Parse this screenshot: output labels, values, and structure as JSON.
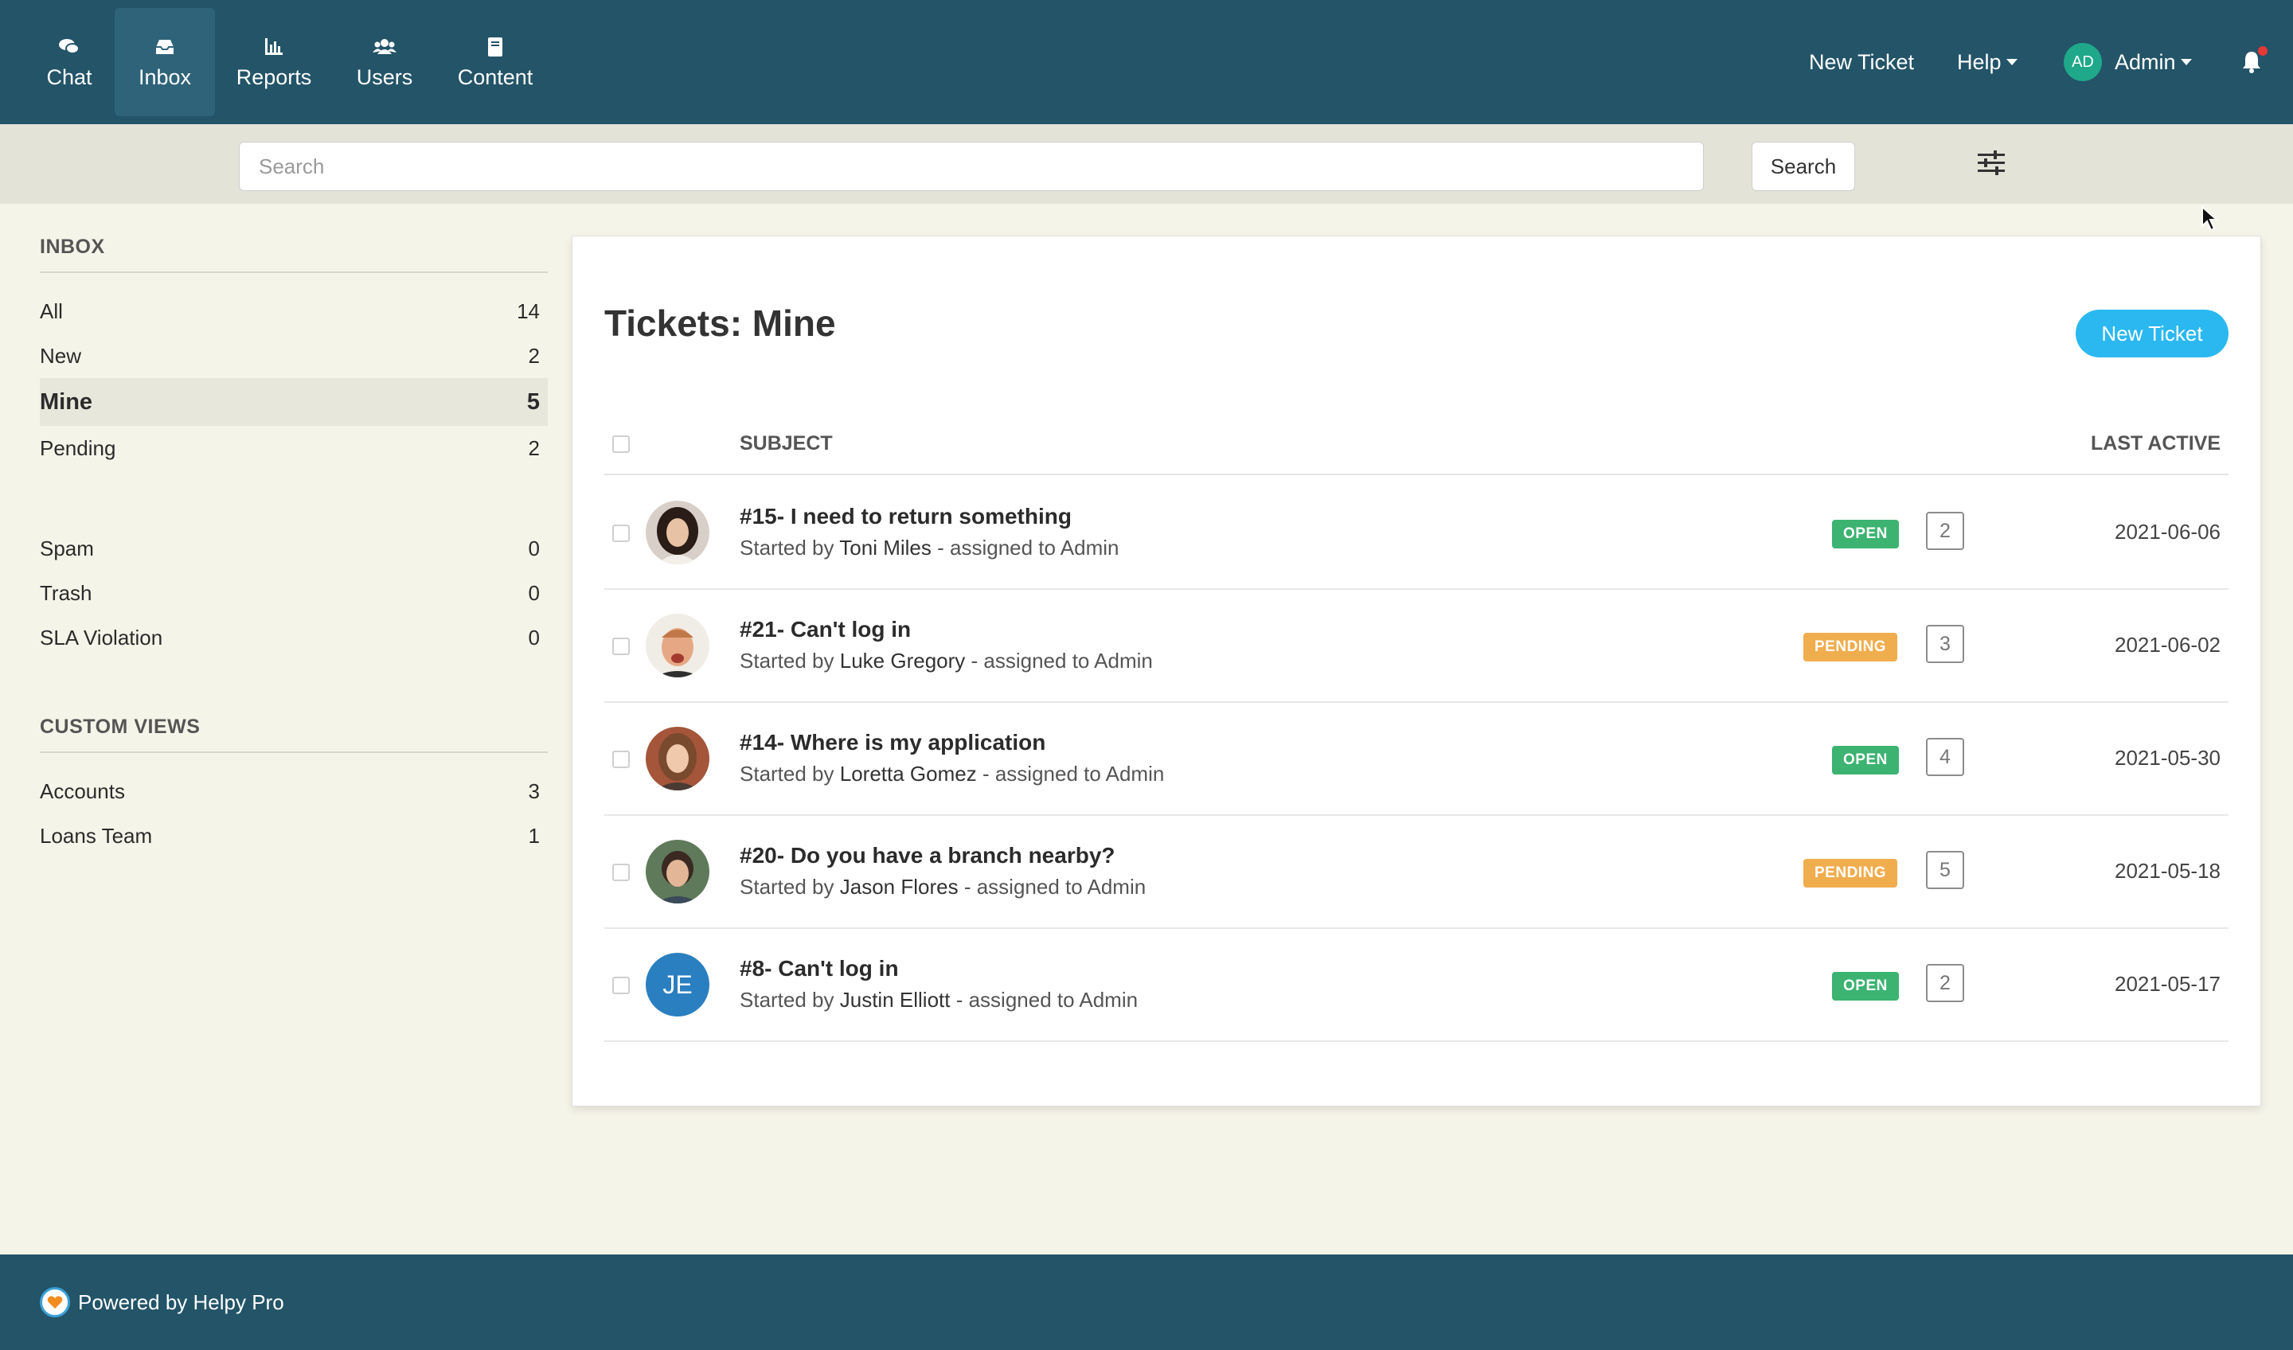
{
  "nav": {
    "items": [
      {
        "label": "Chat",
        "icon": "chat-icon"
      },
      {
        "label": "Inbox",
        "icon": "inbox-icon",
        "active": true
      },
      {
        "label": "Reports",
        "icon": "bar-chart-icon"
      },
      {
        "label": "Users",
        "icon": "users-icon"
      },
      {
        "label": "Content",
        "icon": "book-icon"
      }
    ],
    "new_ticket": "New Ticket",
    "help": "Help",
    "user_initials": "AD",
    "user_name": "Admin"
  },
  "search": {
    "placeholder": "Search",
    "button_label": "Search"
  },
  "sidebar": {
    "inbox_heading": "INBOX",
    "inbox_items": [
      {
        "label": "All",
        "count": "14"
      },
      {
        "label": "New",
        "count": "2"
      },
      {
        "label": "Mine",
        "count": "5",
        "active": true
      },
      {
        "label": "Pending",
        "count": "2"
      }
    ],
    "other_items": [
      {
        "label": "Spam",
        "count": "0"
      },
      {
        "label": "Trash",
        "count": "0"
      },
      {
        "label": "SLA Violation",
        "count": "0"
      }
    ],
    "custom_heading": "CUSTOM VIEWS",
    "custom_items": [
      {
        "label": "Accounts",
        "count": "3"
      },
      {
        "label": "Loans Team",
        "count": "1"
      }
    ]
  },
  "main": {
    "title": "Tickets: Mine",
    "new_ticket_button": "New Ticket",
    "columns": {
      "subject": "SUBJECT",
      "last_active": "LAST ACTIVE"
    },
    "tickets": [
      {
        "subject": "#15- I need to return something",
        "started_by": "Started by",
        "author": "Toni Miles",
        "assigned": "- assigned to Admin",
        "status": "OPEN",
        "replies": "2",
        "date": "2021-06-06"
      },
      {
        "subject": "#21- Can't log in",
        "started_by": "Started by",
        "author": "Luke Gregory",
        "assigned": "- assigned to Admin",
        "status": "PENDING",
        "replies": "3",
        "date": "2021-06-02"
      },
      {
        "subject": "#14- Where is my application",
        "started_by": "Started by",
        "author": "Loretta Gomez",
        "assigned": "- assigned to Admin",
        "status": "OPEN",
        "replies": "4",
        "date": "2021-05-30"
      },
      {
        "subject": "#20- Do you have a branch nearby?",
        "started_by": "Started by",
        "author": "Jason Flores",
        "assigned": "- assigned to Admin",
        "status": "PENDING",
        "replies": "5",
        "date": "2021-05-18"
      },
      {
        "subject": "#8- Can't log in",
        "started_by": "Started by",
        "author": "Justin Elliott",
        "assigned": "- assigned to Admin",
        "status": "OPEN",
        "replies": "2",
        "date": "2021-05-17",
        "initials": "JE"
      }
    ]
  },
  "colors": {
    "nav_bg": "#235468",
    "open_badge": "#3cb371",
    "pending_badge": "#f0ad4e",
    "primary_button": "#2bb8f0"
  },
  "footer": {
    "text": "Powered by Helpy Pro"
  }
}
